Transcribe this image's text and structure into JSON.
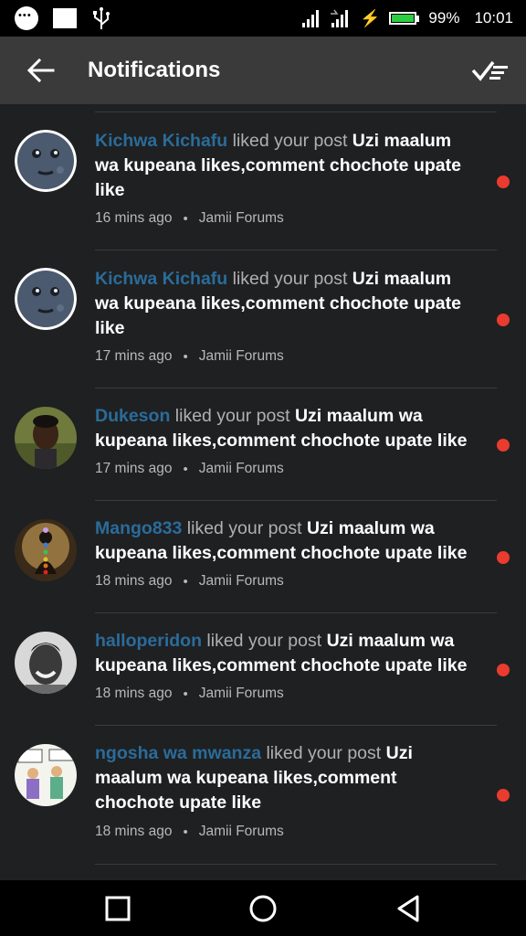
{
  "status_bar": {
    "battery": "99%",
    "battery_level": 0.99,
    "time": "10:01",
    "icons": [
      "message-icon",
      "image-icon",
      "usb-icon",
      "signal-icon",
      "signal-icon",
      "charging-icon",
      "battery-icon"
    ]
  },
  "header": {
    "title": "Notifications",
    "back_icon": "arrow-left-icon",
    "mark_read_icon": "check-list-icon"
  },
  "notifications": [
    {
      "user": "Kichwa Kichafu",
      "action": "liked your post",
      "post": "Uzi maalum wa kupeana likes,comment chochote upate like",
      "time": "16 mins ago",
      "separator": "•",
      "source": "Jamii Forums",
      "avatar": "moon-face"
    },
    {
      "user": "Kichwa Kichafu",
      "action": "liked your post",
      "post": "Uzi maalum wa kupeana likes,comment chochote upate like",
      "time": "17 mins ago",
      "separator": "•",
      "source": "Jamii Forums",
      "avatar": "moon-face"
    },
    {
      "user": "Dukeson",
      "action": "liked your post",
      "post": "Uzi maalum wa kupeana likes,comment chochote upate like",
      "time": "17 mins ago",
      "separator": "•",
      "source": "Jamii Forums",
      "avatar": "photo-man"
    },
    {
      "user": "Mango833",
      "action": "liked your post",
      "post": "Uzi maalum wa kupeana likes,comment chochote upate like",
      "time": "18 mins ago",
      "separator": "•",
      "source": "Jamii Forums",
      "avatar": "meditation"
    },
    {
      "user": "halloperidon",
      "action": "liked your post",
      "post": "Uzi maalum wa kupeana likes,comment chochote upate like",
      "time": "18 mins ago",
      "separator": "•",
      "source": "Jamii Forums",
      "avatar": "photo-smiling-man"
    },
    {
      "user": "ngosha wa mwanza",
      "action": "liked your post",
      "post": "Uzi maalum wa kupeana likes,comment chochote upate like",
      "time": "18 mins ago",
      "separator": "•",
      "source": "Jamii Forums",
      "avatar": "cartoon"
    }
  ],
  "colors": {
    "username": "#2a6c9a",
    "unread_dot": "#ea3b2f",
    "background": "#1f2022",
    "app_bar": "#3a3a3b"
  },
  "nav_bar": {
    "icons": [
      "square-icon",
      "circle-icon",
      "triangle-back-icon"
    ]
  }
}
